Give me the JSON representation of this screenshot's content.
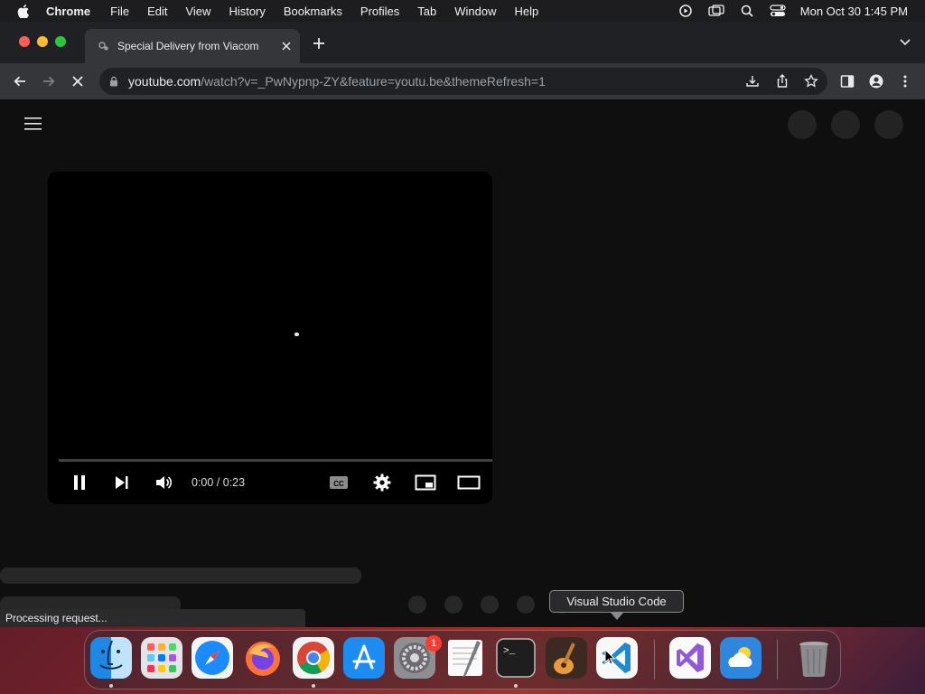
{
  "menubar": {
    "app_name": "Chrome",
    "menus": [
      "File",
      "Edit",
      "View",
      "History",
      "Bookmarks",
      "Profiles",
      "Tab",
      "Window",
      "Help"
    ],
    "clock": "Mon Oct 30  1:45 PM"
  },
  "browser": {
    "tab_title": "Special Delivery from Viacom",
    "url_host": "youtube.com",
    "url_path": "/watch?v=_PwNypnp-ZY&feature=youtu.be&themeRefresh=1"
  },
  "player": {
    "time_display": "0:00 / 0:23",
    "progress_fraction": 0.0
  },
  "status_text": "Processing request...",
  "tooltip": "Visual Studio Code",
  "dock": {
    "badge_count": "1",
    "apps": [
      "finder",
      "launchpad",
      "safari",
      "firefox",
      "chrome",
      "app-store",
      "system-settings",
      "textedit",
      "terminal",
      "garageband",
      "visual-studio-code",
      "visual-studio",
      "weather",
      "trash"
    ]
  },
  "colors": {
    "accent_blue": "#1a73e8",
    "close_red": "#ff5f57",
    "minimize_yellow": "#febc2e",
    "maximize_green": "#28c840",
    "badge_red": "#ff3b30"
  }
}
